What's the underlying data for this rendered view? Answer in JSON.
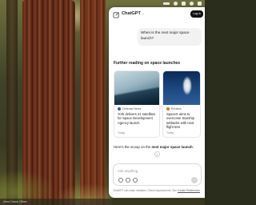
{
  "header": {
    "app_title": "ChatGPT",
    "login_label": "Log in"
  },
  "conversation": {
    "user_message": "When is the next major space launch?",
    "further_reading_title": "Further reading on space launches",
    "articles": [
      {
        "source": "Defense News",
        "headline": "York delivers 21 satellites for Space Development Agency launch",
        "date": "Today"
      },
      {
        "source": "Reuters",
        "headline": "SpaceX aims to overcome Starship setbacks with next flight test",
        "date": "Today"
      }
    ],
    "scoop_prefix": "Here's the scoop on the ",
    "scoop_bold": "next major space launch",
    "scoop_suffix": ":"
  },
  "composer": {
    "placeholder": "Ask anything"
  },
  "disclaimer": {
    "text": "ChatGPT can make mistakes. Check important info. See ",
    "link": "Cookie Preferences",
    "end": "."
  },
  "dock": {
    "text": "Alexa Classic Offices"
  },
  "colors": {
    "panel_bg": "#ffffff",
    "login_bg": "#111111",
    "bubble_bg": "#f2f2f2"
  }
}
